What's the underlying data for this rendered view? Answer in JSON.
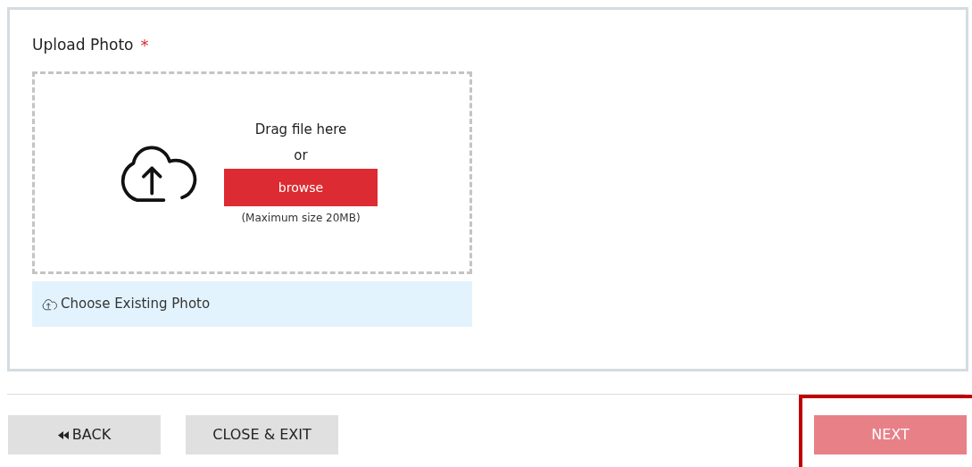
{
  "upload": {
    "label": "Upload Photo",
    "required_mark": "*",
    "drop_text": "Drag file here",
    "or_text": "or",
    "browse_button": "browse",
    "size_note": "(Maximum size 20MB)",
    "existing_link": "Choose Existing Photo"
  },
  "footer": {
    "buttons": [
      {
        "kind": "back",
        "label": "BACK",
        "disabled": false,
        "highlighted": false
      },
      {
        "kind": "plain",
        "label": "CLOSE & EXIT",
        "disabled": false,
        "highlighted": false
      },
      {
        "kind": "plain",
        "label": "NEXT",
        "disabled": true,
        "highlighted": true
      }
    ]
  }
}
